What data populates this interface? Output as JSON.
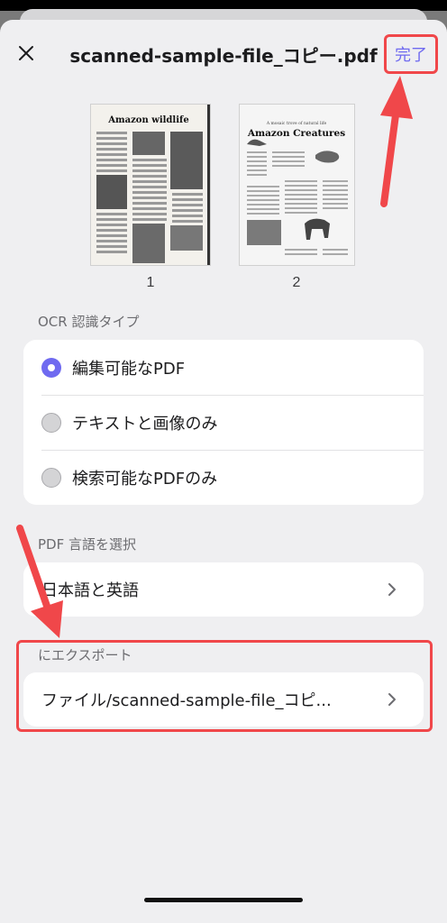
{
  "header": {
    "title": "scanned-sample-file_コピー.pdf",
    "done_label": "完了"
  },
  "thumbnails": [
    {
      "page": "1",
      "heading": "Amazon wildlife"
    },
    {
      "page": "2",
      "small": "A mosaic trove of natural life",
      "heading": "Amazon Creatures"
    }
  ],
  "ocr": {
    "section_label": "OCR 認識タイプ",
    "options": [
      {
        "label": "編集可能なPDF",
        "selected": true
      },
      {
        "label": "テキストと画像のみ",
        "selected": false
      },
      {
        "label": "検索可能なPDFのみ",
        "selected": false
      }
    ]
  },
  "language": {
    "section_label": "PDF 言語を選択",
    "value": "日本語と英語"
  },
  "export": {
    "section_label": "にエクスポート",
    "value": "ファイル/scanned-sample-file_コピ..."
  },
  "colors": {
    "accent": "#6f6af0",
    "highlight": "#f0474a"
  }
}
